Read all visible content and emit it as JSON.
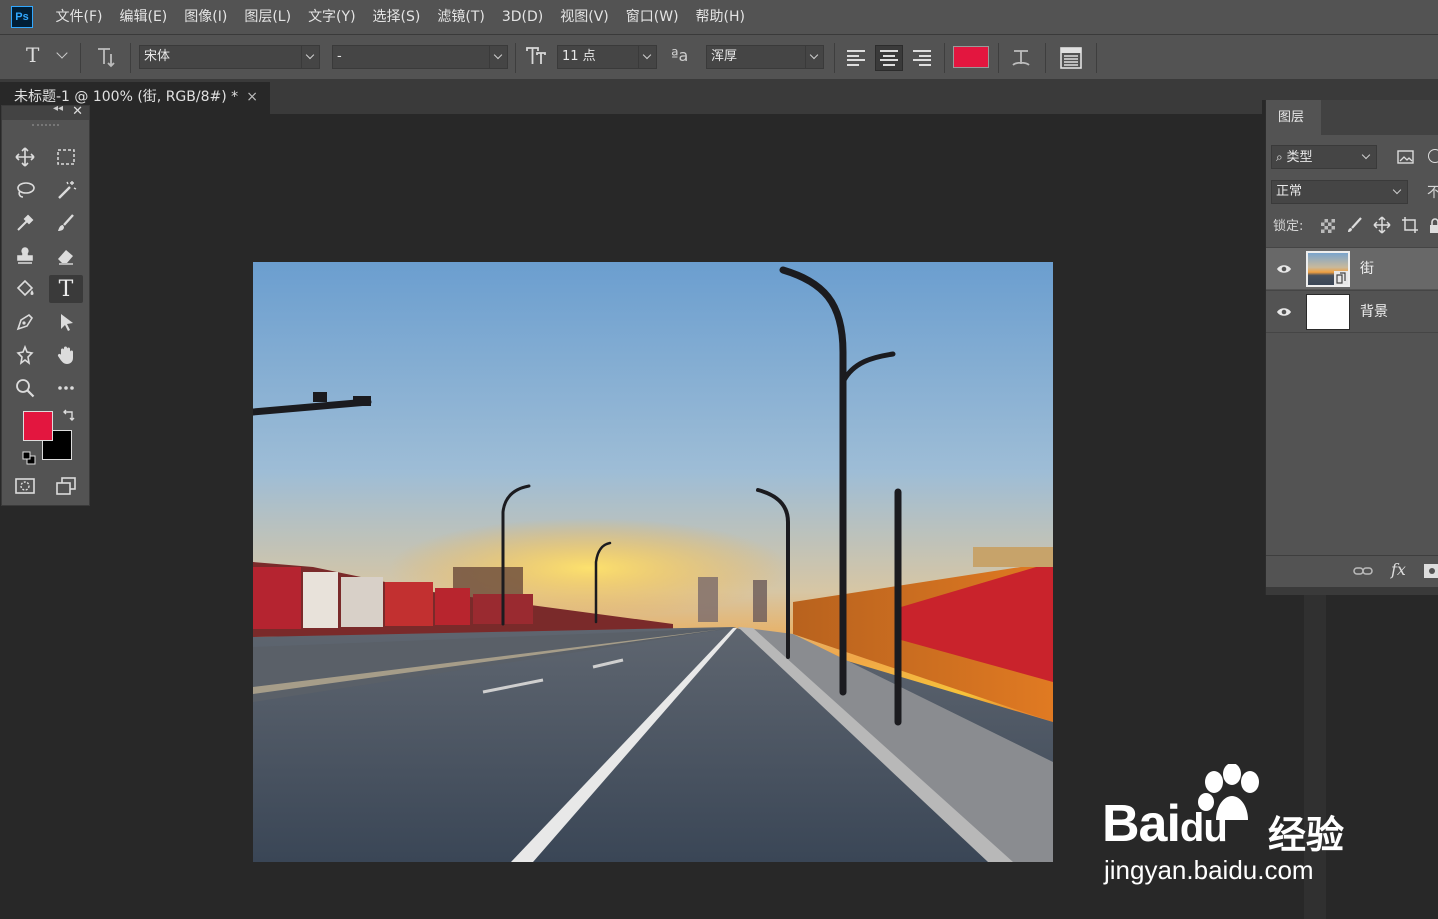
{
  "app": {
    "logo": "Ps"
  },
  "menu": [
    "文件(F)",
    "编辑(E)",
    "图像(I)",
    "图层(L)",
    "文字(Y)",
    "选择(S)",
    "滤镜(T)",
    "3D(D)",
    "视图(V)",
    "窗口(W)",
    "帮助(H)"
  ],
  "options": {
    "font_family": "宋体",
    "font_style": "-",
    "font_size": "11 点",
    "antialias_label": "ªa",
    "antialias": "浑厚",
    "text_color": "#e3163f"
  },
  "document": {
    "tab_title": "未标题-1 @ 100% (街, RGB/8#) *",
    "close_glyph": "×"
  },
  "toolbox": {
    "foreground": "#e3163f",
    "background": "#000000",
    "tools": [
      "move-tool",
      "marquee-tool",
      "lasso-tool",
      "magic-wand-tool",
      "eyedropper-tool",
      "brush-tool",
      "stamp-tool",
      "eraser-tool",
      "bucket-tool",
      "type-tool",
      "pen-tool",
      "path-select-tool",
      "shape-tool",
      "hand-tool",
      "zoom-tool",
      "more-tool"
    ]
  },
  "layers_panel": {
    "tab": "图层",
    "filter_kind": "类型",
    "blend_mode": "正常",
    "opacity_label": "不",
    "lock_label": "锁定:",
    "layers": [
      {
        "name": "街",
        "selected": true,
        "visible": true
      },
      {
        "name": "背景",
        "selected": false,
        "visible": true
      }
    ],
    "fx_label": "fx"
  },
  "watermark": {
    "brand": "Bai",
    "brand_mid": "du",
    "brand_cn": "经验",
    "url": "jingyan.baidu.com"
  }
}
